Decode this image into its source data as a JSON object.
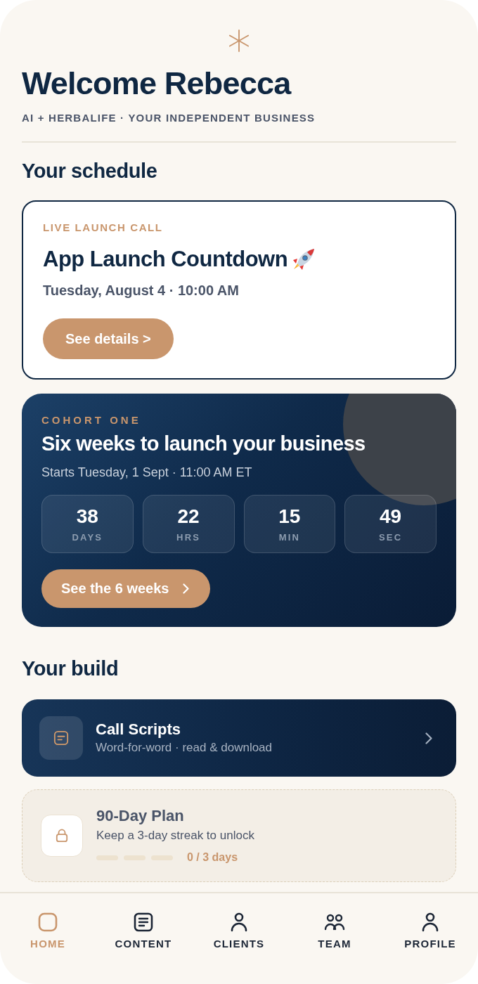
{
  "header": {
    "title": "Welcome Rebecca",
    "subtitle": "AI + HERBALIFE · YOUR INDEPENDENT BUSINESS"
  },
  "schedule": {
    "heading": "Your schedule",
    "event": {
      "eyebrow": "LIVE LAUNCH CALL",
      "title": "App Launch Countdown",
      "datetime": "Tuesday, August 4 · 10:00 AM",
      "button": "See details >"
    }
  },
  "cohort": {
    "eyebrow": "COHORT ONE",
    "title": "Six weeks to launch your business",
    "subtitle": "Starts Tuesday, 1 Sept · 11:00 AM ET",
    "countdown": [
      {
        "value": "38",
        "unit": "DAYS"
      },
      {
        "value": "22",
        "unit": "HRS"
      },
      {
        "value": "15",
        "unit": "MIN"
      },
      {
        "value": "49",
        "unit": "SEC"
      }
    ],
    "button": "See the 6 weeks"
  },
  "build": {
    "heading": "Your build",
    "items": [
      {
        "kind": "link",
        "title": "Call Scripts",
        "subtitle": "Word-for-word · read & download"
      },
      {
        "kind": "locked",
        "title": "90-Day Plan",
        "subtitle": "Keep a 3-day streak to unlock",
        "streak": [
          {
            "filled": false
          },
          {
            "filled": false
          },
          {
            "filled": false
          }
        ],
        "progress": "0 / 3 days"
      }
    ]
  },
  "nav": [
    {
      "label": "HOME",
      "selected": true
    },
    {
      "label": "CONTENT",
      "selected": false
    },
    {
      "label": "CLIENTS",
      "selected": false
    },
    {
      "label": "TEAM",
      "selected": false
    },
    {
      "label": "PROFILE",
      "selected": false
    }
  ]
}
